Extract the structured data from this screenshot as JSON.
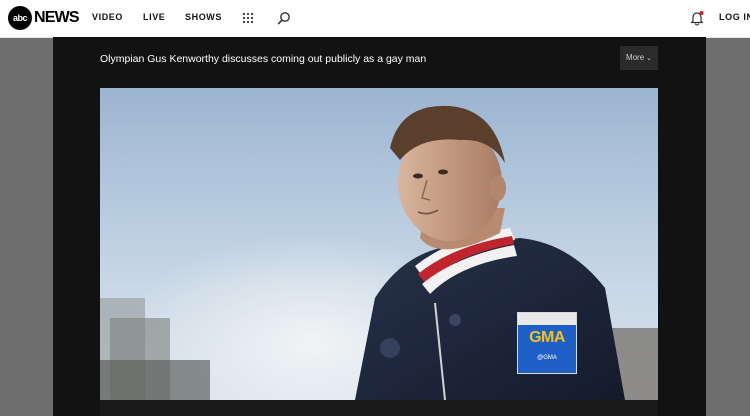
{
  "header": {
    "logo_mark": "abc",
    "logo_text": "NEWS",
    "nav": [
      {
        "label": "VIDEO"
      },
      {
        "label": "LIVE"
      },
      {
        "label": "SHOWS"
      }
    ],
    "grid_icon": "apps-grid-icon",
    "search_icon": "search-icon",
    "notification_icon": "bell-icon",
    "notification_color": "#e0191e",
    "login_label": "LOG IN"
  },
  "player": {
    "title": "Olympian Gus Kenworthy discusses coming out publicly as a gay man",
    "more_label": "More",
    "badge": {
      "brand": "GMA",
      "handle": "@GMA",
      "brand_color": "#f2c21a",
      "bg_color": "#1f60c8"
    }
  }
}
